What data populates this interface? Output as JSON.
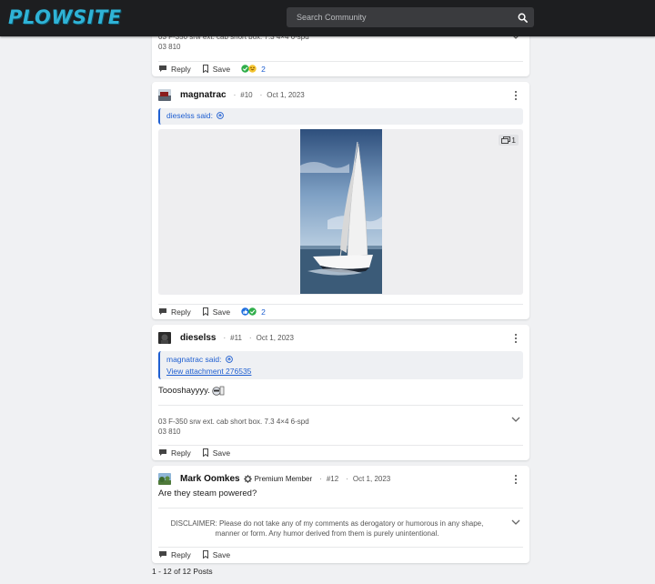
{
  "header": {
    "logo": "PLOWSITE",
    "search_placeholder": "Search Community"
  },
  "post9": {
    "signature_line1": "03 F-350 srw ext. cab short box. 7.3 4×4 6-spd",
    "signature_line2": "03 810",
    "reply": "Reply",
    "save": "Save",
    "reaction_count": "2"
  },
  "post10": {
    "username": "magnatrac",
    "number": "#10",
    "date": "Oct 1, 2023",
    "quote_author": "dieselss said:",
    "attachment_count": "1",
    "reply": "Reply",
    "save": "Save",
    "reaction_count": "2"
  },
  "post11": {
    "username": "dieselss",
    "number": "#11",
    "date": "Oct 1, 2023",
    "quote_author": "magnatrac said:",
    "quote_link": "View attachment 276535",
    "body": "Toooshayyyy.",
    "signature_line1": "03 F-350 srw ext. cab short box. 7.3 4×4 6-spd",
    "signature_line2": "03 810",
    "reply": "Reply",
    "save": "Save"
  },
  "post12": {
    "username": "Mark Oomkes",
    "badge": "Premium Member",
    "number": "#12",
    "date": "Oct 1, 2023",
    "body": "Are they steam powered?",
    "signature": "DISCLAIMER: Please do not take any of my comments as derogatory or humorous in any shape, manner or form. Any humor derived from them is purely unintentional.",
    "reply": "Reply",
    "save": "Save"
  },
  "footer": {
    "post_count": "1 - 12 of 12 Posts"
  },
  "colors": {
    "accent": "#1f5fd1",
    "logo": "#2fb3d6",
    "header_bg": "#1d1e20"
  }
}
